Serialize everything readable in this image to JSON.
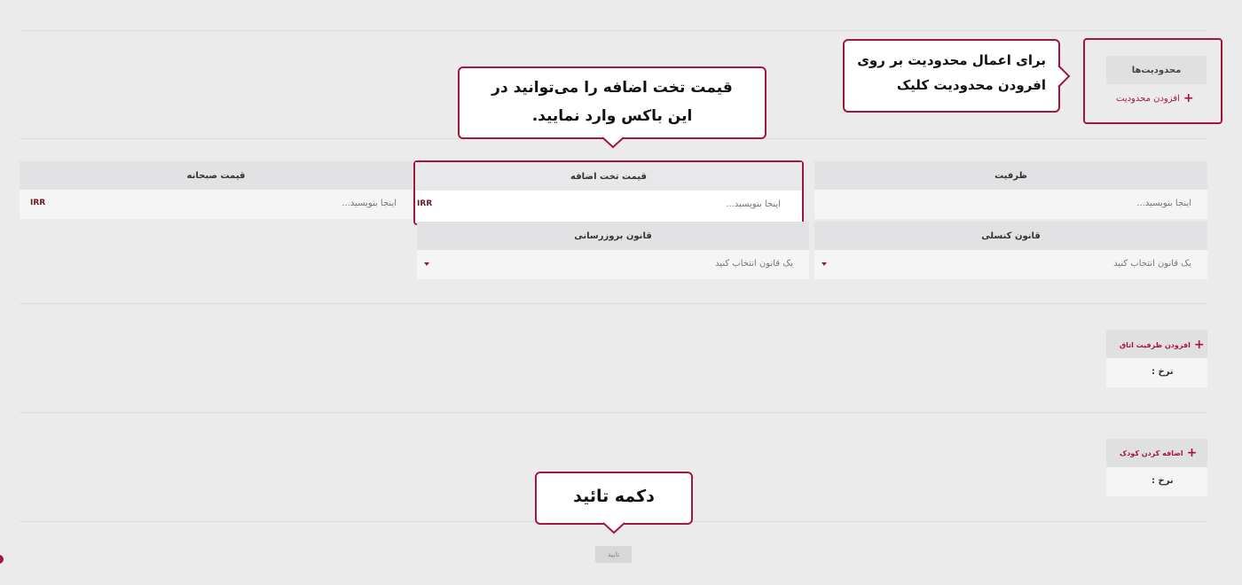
{
  "restrictions": {
    "title": "محدودیت‌ها",
    "add_label": "افزودن محدودیت"
  },
  "callouts": {
    "restriction_line1": "برای اعمال محدودیت بر روی",
    "restriction_line2": "افرودن محدودیت کلیک",
    "extra_bed_line1": "قیمت تخت اضافه را می‌توانید در",
    "extra_bed_line2": "این باکس وارد نمایید.",
    "confirm": "دکمه تائید"
  },
  "fields": {
    "capacity": {
      "label": "ظرفیت",
      "placeholder": "اینجا بنویسید..."
    },
    "extra_bed": {
      "label": "قیمت تخت اضافه",
      "placeholder": "اینجا بنویسید...",
      "currency": "IRR"
    },
    "breakfast": {
      "label": "قیمت صبحانه",
      "placeholder": "اینجا بنویسید...",
      "currency": "IRR"
    },
    "consular_rule": {
      "label": "قانون کنسلی",
      "placeholder": "یک قانون انتخاب کنید"
    },
    "update_rule": {
      "label": "قانون بروزرسانی",
      "placeholder": "یک قانون انتخاب کنید"
    }
  },
  "room_capacity": {
    "add_label": "افزودن ظرفیت اتاق",
    "rate_label": "نرخ :"
  },
  "child": {
    "add_label": "اضافه کردن کودک",
    "rate_label": "نرخ :"
  },
  "confirm_button": "تایید",
  "colors": {
    "accent": "#a3173a",
    "background": "#ebebeb",
    "header": "#e2e2e4"
  }
}
